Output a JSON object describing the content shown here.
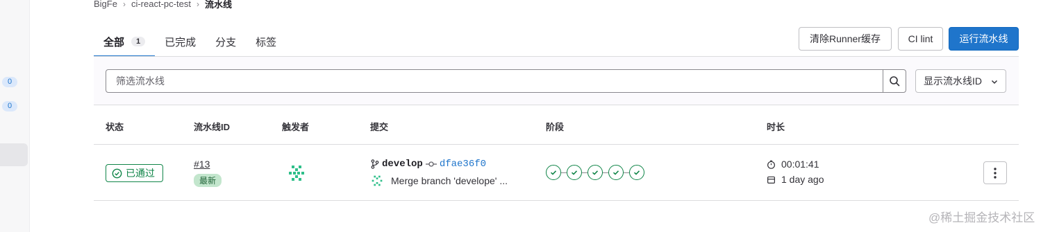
{
  "breadcrumb": {
    "group": "BigFe",
    "project": "ci-react-pc-test",
    "current": "流水线"
  },
  "sidebar": {
    "badges": [
      "0",
      "0"
    ]
  },
  "tabs": [
    {
      "label": "全部",
      "count": "1"
    },
    {
      "label": "已完成"
    },
    {
      "label": "分支"
    },
    {
      "label": "标签"
    }
  ],
  "actions": {
    "clear_cache": "清除Runner缓存",
    "ci_lint": "CI lint",
    "run_pipeline": "运行流水线"
  },
  "filter": {
    "placeholder": "筛选流水线",
    "id_dropdown": "显示流水线ID"
  },
  "table": {
    "headers": {
      "status": "状态",
      "pipeline_id": "流水线ID",
      "triggerer": "触发者",
      "commit": "提交",
      "stages": "阶段",
      "duration": "时长"
    },
    "row": {
      "status": "已通过",
      "pipeline_id": "#13",
      "latest": "最新",
      "branch": "develop",
      "sha": "dfae36f0",
      "message": "Merge branch 'develope' ...",
      "stage_count": 5,
      "duration": "00:01:41",
      "finished": "1 day ago"
    }
  },
  "colors": {
    "accent": "#1f75cb",
    "success": "#108548"
  },
  "watermark": "@稀土掘金技术社区"
}
